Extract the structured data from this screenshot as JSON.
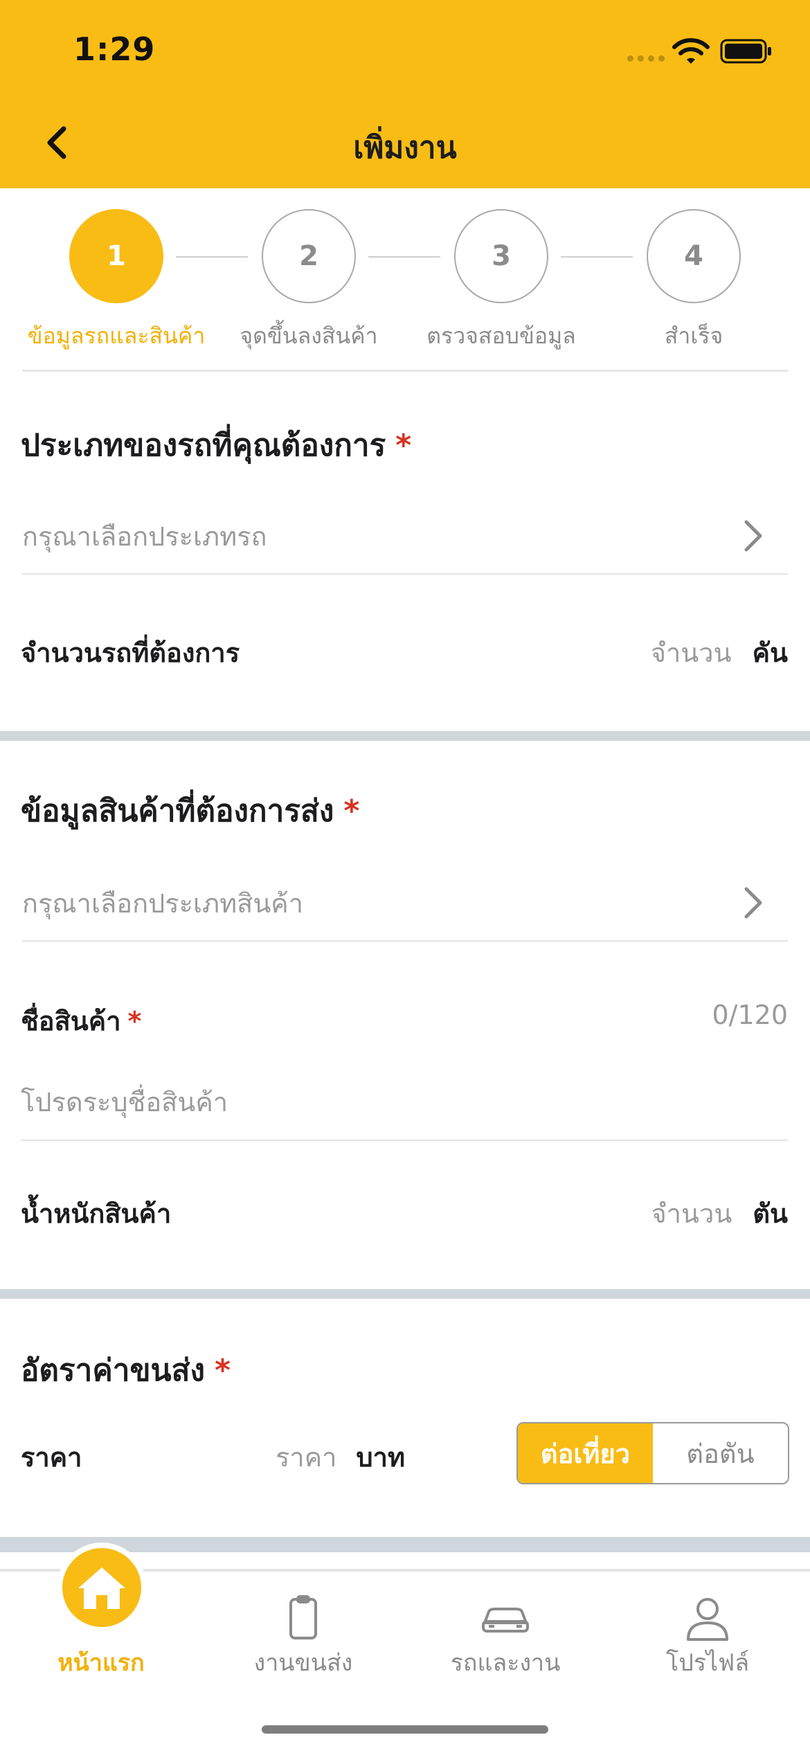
{
  "status_bar": {
    "time": "1:29"
  },
  "header": {
    "title": "เพิ่มงาน"
  },
  "stepper": {
    "steps": [
      {
        "number": "1",
        "label": "ข้อมูลรถและสินค้า"
      },
      {
        "number": "2",
        "label": "จุดขึ้นลงสินค้า"
      },
      {
        "number": "3",
        "label": "ตรวจสอบข้อมูล"
      },
      {
        "number": "4",
        "label": "สำเร็จ"
      }
    ]
  },
  "vehicle": {
    "title": "ประเภทของรถที่คุณต้องการ",
    "required_mark": "*",
    "type_placeholder": "กรุณาเลือกประเภทรถ",
    "count_label": "จำนวนรถที่ต้องการ",
    "count_placeholder": "จำนวน",
    "count_unit": "คัน"
  },
  "goods": {
    "title": "ข้อมูลสินค้าที่ต้องการส่ง",
    "required_mark": "*",
    "type_placeholder": "กรุณาเลือกประเภทสินค้า",
    "name_label": "ชื่อสินค้า",
    "name_required_mark": "*",
    "name_counter": "0/120",
    "name_placeholder": "โปรดระบุชื่อสินค้า",
    "weight_label": "น้ำหนักสินค้า",
    "weight_placeholder": "จำนวน",
    "weight_unit": "ตัน"
  },
  "rate": {
    "title": "อัตราค่าขนส่ง",
    "required_mark": "*",
    "price_label": "ราคา",
    "price_placeholder": "ราคา",
    "price_unit": "บาท",
    "options": [
      "ต่อเที่ยว",
      "ต่อตัน"
    ],
    "selected": "ต่อเที่ยว"
  },
  "tabbar": {
    "items": [
      {
        "label": "หน้าแรก",
        "icon": "home-icon"
      },
      {
        "label": "งานขนส่ง",
        "icon": "clipboard-icon"
      },
      {
        "label": "รถและงาน",
        "icon": "car-icon"
      },
      {
        "label": "โปรไฟล์",
        "icon": "user-icon"
      }
    ]
  },
  "colors": {
    "accent": "#F8BC15",
    "required": "#D9321F",
    "separator": "#CFD6DC"
  }
}
